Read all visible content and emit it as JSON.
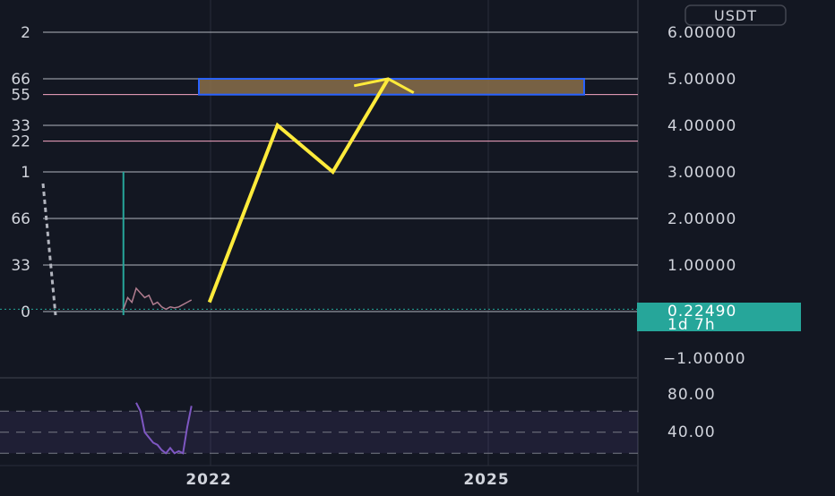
{
  "chart_data": {
    "type": "line",
    "currency": "USDT",
    "price_axis": {
      "ticks": [
        "6.00000",
        "5.00000",
        "4.00000",
        "3.00000",
        "2.00000",
        "1.00000",
        "−1.00000"
      ],
      "ylim": [
        -1.2,
        6.6
      ]
    },
    "current_price": {
      "value": "0.22490",
      "countdown": "1d 7h",
      "color": "#26a69a"
    },
    "time_axis": {
      "ticks": [
        "2022",
        "2025"
      ]
    },
    "fib_levels": [
      {
        "label": "2",
        "price": 6.0,
        "color": "#b2b5be"
      },
      {
        "label": "66",
        "price": 5.0,
        "color": "#b2b5be"
      },
      {
        "label": "55",
        "price": 4.66,
        "color": "#f7a6c4"
      },
      {
        "label": "33",
        "price": 4.0,
        "color": "#b2b5be"
      },
      {
        "label": "22",
        "price": 3.66,
        "color": "#f7a6c4"
      },
      {
        "label": "1",
        "price": 3.0,
        "color": "#b2b5be"
      },
      {
        "label": "66",
        "price": 2.0,
        "color": "#b2b5be"
      },
      {
        "label": "33",
        "price": 1.0,
        "color": "#b2b5be"
      },
      {
        "label": "0",
        "price": 0.0,
        "color": "#b2b5be"
      }
    ],
    "target_zone": {
      "price_from": 4.66,
      "price_to": 5.0,
      "fill": "#8a6f4a",
      "border": "#2962ff"
    },
    "projection": {
      "color": "#ffeb3b",
      "points": [
        [
          0.225,
          0.2
        ],
        [
          0.305,
          4.0
        ],
        [
          0.37,
          3.0
        ],
        [
          0.435,
          5.0
        ]
      ],
      "arrow_head": [
        [
          0.395,
          4.85
        ],
        [
          0.435,
          5.0
        ],
        [
          0.465,
          4.7
        ]
      ]
    },
    "candle_spike": {
      "x": 0.145,
      "high": 3.0,
      "color": "#26a69a"
    },
    "price_series": {
      "x": [
        0.145,
        0.15,
        0.155,
        0.16,
        0.165,
        0.17,
        0.175,
        0.18,
        0.185,
        0.19,
        0.195,
        0.2,
        0.205,
        0.21,
        0.215,
        0.22,
        0.225
      ],
      "y": [
        0.05,
        0.3,
        0.2,
        0.5,
        0.4,
        0.3,
        0.35,
        0.15,
        0.2,
        0.1,
        0.05,
        0.1,
        0.08,
        0.1,
        0.15,
        0.2,
        0.25
      ]
    },
    "rsi": {
      "ticks": [
        "80.00",
        "40.00"
      ],
      "range": [
        20,
        100
      ],
      "band": [
        30,
        70
      ],
      "color": "#7e57c2",
      "x": [
        0.16,
        0.165,
        0.17,
        0.175,
        0.18,
        0.185,
        0.19,
        0.195,
        0.2,
        0.205,
        0.21,
        0.215,
        0.22,
        0.225
      ],
      "y": [
        78,
        70,
        50,
        45,
        40,
        38,
        33,
        30,
        35,
        30,
        32,
        30,
        55,
        75
      ]
    }
  }
}
